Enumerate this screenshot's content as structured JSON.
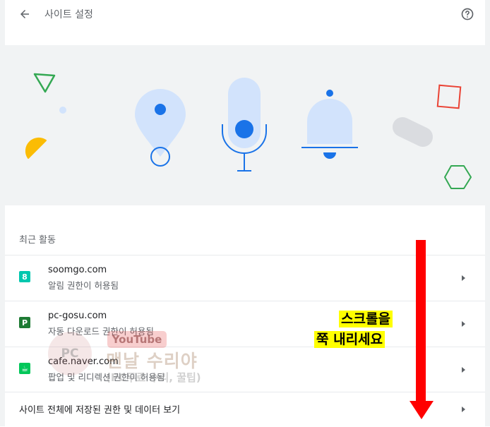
{
  "header": {
    "title": "사이트 설정"
  },
  "recent": {
    "section_label": "최근 활동",
    "items": [
      {
        "domain": "soomgo.com",
        "desc": "알림 권한이 허용됨",
        "favicon_char": "8",
        "favicon_color": "#00c7ae"
      },
      {
        "domain": "pc-gosu.com",
        "desc": "자동 다운로드 권한이 허용됨",
        "favicon_char": "P",
        "favicon_color": "#1e7b34"
      },
      {
        "domain": "cafe.naver.com",
        "desc": "팝업 및 리디렉션 권한이 허용됨",
        "favicon_char": "☕",
        "favicon_color": "#03c75a"
      }
    ]
  },
  "footer_link": {
    "label": "사이트 전체에 저장된 권한 및 데이터 보기"
  },
  "annotation": {
    "line1": "스크롤을",
    "line2": "쭉 내리세요",
    "arrow_color": "#ff0000",
    "highlight_color": "#ffff00"
  },
  "watermark": {
    "badge": "PC",
    "youtube": "YouTube",
    "channel": "맨날 수리야",
    "sub": "(PC무료 수리, 꿀팁)"
  },
  "icons": {
    "back": "arrow-left-icon",
    "help": "help-circle-icon",
    "chevron": "chevron-right-icon",
    "illustrations": [
      "location-pin-icon",
      "microphone-icon",
      "bell-icon"
    ]
  },
  "colors": {
    "accent": "#1a73e8",
    "light_blue": "#d2e3fc",
    "muted_text": "#5f6368",
    "hero_bg": "#f1f3f4"
  }
}
